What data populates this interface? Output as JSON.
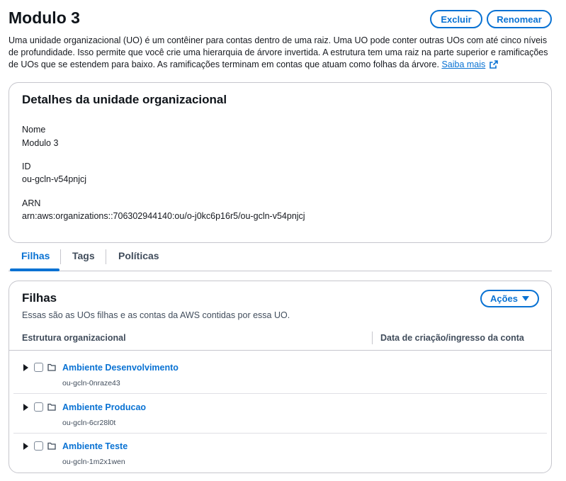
{
  "header": {
    "title": "Modulo 3",
    "delete_label": "Excluir",
    "rename_label": "Renomear"
  },
  "description": {
    "text": "Uma unidade organizacional (UO) é um contêiner para contas dentro de uma raiz. Uma UO pode conter outras UOs com até cinco níveis de profundidade. Isso permite que você crie uma hierarquia de árvore invertida. A estrutura tem uma raiz na parte superior e ramificações de UOs que se estendem para baixo. As ramificações terminam em contas que atuam como folhas da árvore.",
    "learn_more": "Saiba mais"
  },
  "details": {
    "title": "Detalhes da unidade organizacional",
    "name_label": "Nome",
    "name_value": "Modulo 3",
    "id_label": "ID",
    "id_value": "ou-gcln-v54pnjcj",
    "arn_label": "ARN",
    "arn_value": "arn:aws:organizations::706302944140:ou/o-j0kc6p16r5/ou-gcln-v54pnjcj"
  },
  "tabs": [
    {
      "label": "Filhas",
      "active": true
    },
    {
      "label": "Tags",
      "active": false
    },
    {
      "label": "Políticas",
      "active": false
    }
  ],
  "children": {
    "title": "Filhas",
    "description": "Essas são as UOs filhas e as contas da AWS contidas por essa UO.",
    "actions_label": "Ações",
    "columns": [
      "Estrutura organizacional",
      "Data de criação/ingresso da conta"
    ],
    "rows": [
      {
        "name": "Ambiente Desenvolvimento",
        "id": "ou-gcln-0nraze43"
      },
      {
        "name": "Ambiente Producao",
        "id": "ou-gcln-6cr28l0t"
      },
      {
        "name": "Ambiente Teste",
        "id": "ou-gcln-1m2x1wen"
      }
    ]
  },
  "icons": {
    "expand": "caret-right-icon",
    "row_type": "folder-icon",
    "external": "external-link-icon",
    "dropdown": "caret-down-icon"
  },
  "colors": {
    "accent": "#0972d3",
    "text": "#16191f",
    "border": "#c6c6cd"
  }
}
